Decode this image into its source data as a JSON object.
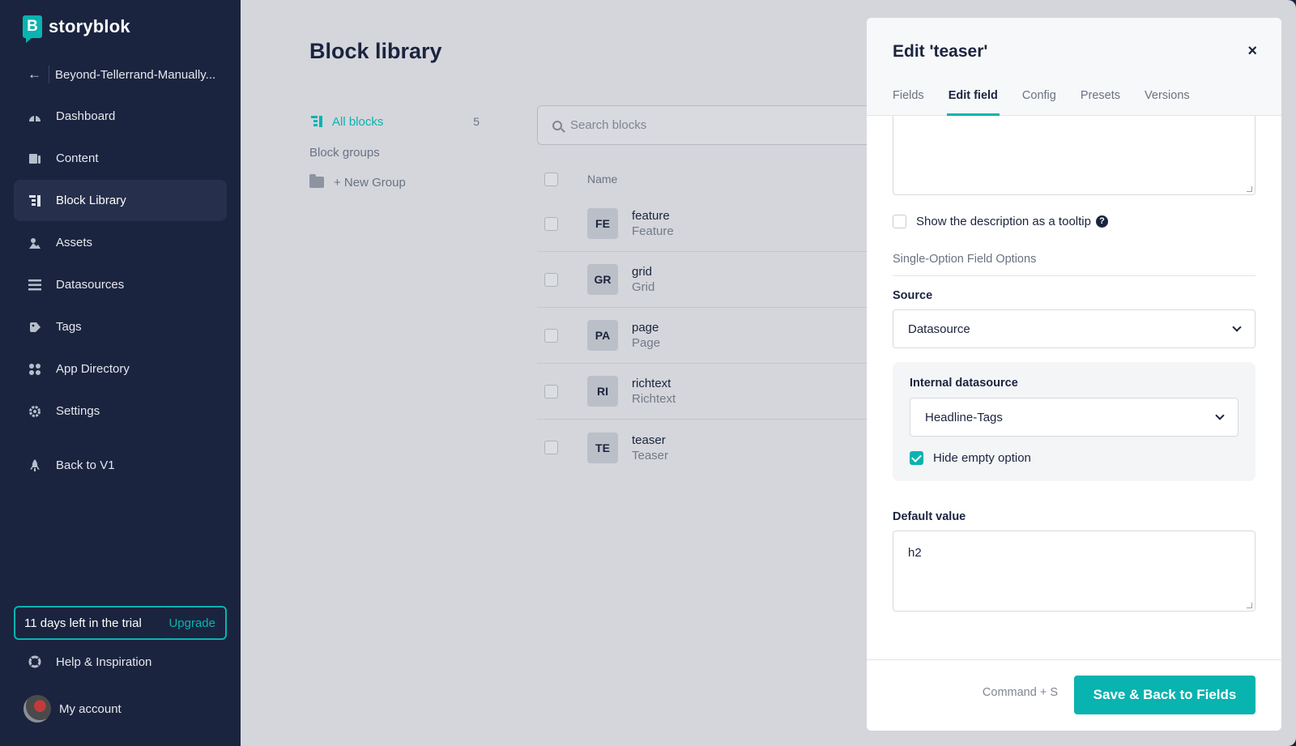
{
  "app": {
    "logo_text": "storyblok",
    "logo_mark": "B"
  },
  "sidebar": {
    "space_name": "Beyond-Tellerrand-Manually...",
    "items": [
      {
        "label": "Dashboard",
        "icon": "dashboard-icon"
      },
      {
        "label": "Content",
        "icon": "content-icon"
      },
      {
        "label": "Block Library",
        "icon": "block-library-icon",
        "active": true
      },
      {
        "label": "Assets",
        "icon": "assets-icon"
      },
      {
        "label": "Datasources",
        "icon": "datasources-icon"
      },
      {
        "label": "Tags",
        "icon": "tags-icon"
      },
      {
        "label": "App Directory",
        "icon": "app-directory-icon"
      },
      {
        "label": "Settings",
        "icon": "gear-icon"
      },
      {
        "label": "Back to V1",
        "icon": "rocket-icon"
      }
    ],
    "trial_text": "11 days left in the trial",
    "upgrade_label": "Upgrade",
    "help_label": "Help & Inspiration",
    "account_label": "My account"
  },
  "main": {
    "title": "Block library",
    "all_blocks_label": "All blocks",
    "all_blocks_count": "5",
    "groups_heading": "Block groups",
    "new_group_label": "+ New Group",
    "search_placeholder": "Search blocks",
    "column_name": "Name",
    "rows": [
      {
        "abbr": "FE",
        "name": "feature",
        "display": "Feature"
      },
      {
        "abbr": "GR",
        "name": "grid",
        "display": "Grid"
      },
      {
        "abbr": "PA",
        "name": "page",
        "display": "Page"
      },
      {
        "abbr": "RI",
        "name": "richtext",
        "display": "Richtext"
      },
      {
        "abbr": "TE",
        "name": "teaser",
        "display": "Teaser"
      }
    ]
  },
  "drawer": {
    "title": "Edit 'teaser'",
    "close_glyph": "×",
    "tabs": [
      {
        "label": "Fields"
      },
      {
        "label": "Edit field",
        "active": true
      },
      {
        "label": "Config"
      },
      {
        "label": "Presets"
      },
      {
        "label": "Versions"
      }
    ],
    "tooltip_label": "Show the description as a tooltip",
    "help_glyph": "?",
    "section_title": "Single-Option Field Options",
    "source_label": "Source",
    "source_value": "Datasource",
    "internal_ds_label": "Internal datasource",
    "internal_ds_value": "Headline-Tags",
    "hide_empty_label": "Hide empty option",
    "default_label": "Default value",
    "default_value": "h2",
    "shortcut": "Command + S",
    "save_label": "Save & Back to Fields"
  },
  "colors": {
    "accent": "#09b3af",
    "sidebar_bg": "#1b243f",
    "main_bg": "#d4d6db"
  }
}
